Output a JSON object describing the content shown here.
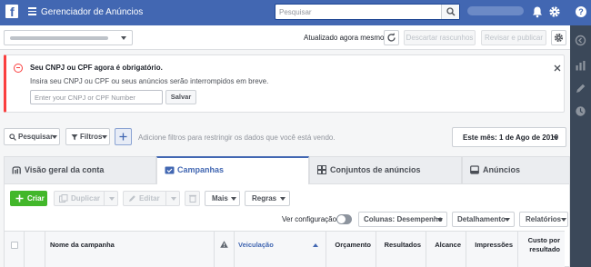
{
  "topbar": {
    "app_title": "Gerenciador de Anúncios",
    "search_placeholder": "Pesquisar",
    "brand_color": "#4267b2"
  },
  "toolbar": {
    "status": "Atualizado agora mesmo",
    "discard_label": "Descartar rascunhos",
    "review_label": "Revisar e publicar"
  },
  "alert": {
    "title": "Seu CNPJ ou CPF agora é obrigatório.",
    "text": "Insira seu CNPJ ou CPF ou seus anúncios serão interrompidos em breve.",
    "input_placeholder": "Enter your CNPJ or CPF Number",
    "save_label": "Salvar",
    "color": "#fa3e3e"
  },
  "filters": {
    "search_label": "Pesquisar",
    "filters_label": "Filtros",
    "hint": "Adicione filtros para restringir os dados que você está vendo.",
    "date_label": "Este mês: 1 de Ago de 2019"
  },
  "tabs": [
    {
      "label": "Visão geral da conta",
      "active": false
    },
    {
      "label": "Campanhas",
      "active": true
    },
    {
      "label": "Conjuntos de anúncios",
      "active": false
    },
    {
      "label": "Anúncios",
      "active": false
    }
  ],
  "actions": {
    "create_label": "Criar",
    "duplicate_label": "Duplicar",
    "edit_label": "Editar",
    "more_label": "Mais",
    "rules_label": "Regras",
    "create_color": "#42b72a"
  },
  "view": {
    "config_label": "Ver configuração",
    "columns_label": "Colunas: Desempenho",
    "breakdown_label": "Detalhamento",
    "reports_label": "Relatórios"
  },
  "table": {
    "headers": {
      "name": "Nome da campanha",
      "delivery": "Veiculação",
      "budget": "Orçamento",
      "results": "Resultados",
      "reach": "Alcance",
      "impressions": "Impressões",
      "cost_line1": "Custo por",
      "cost_line2": "resultado"
    }
  }
}
